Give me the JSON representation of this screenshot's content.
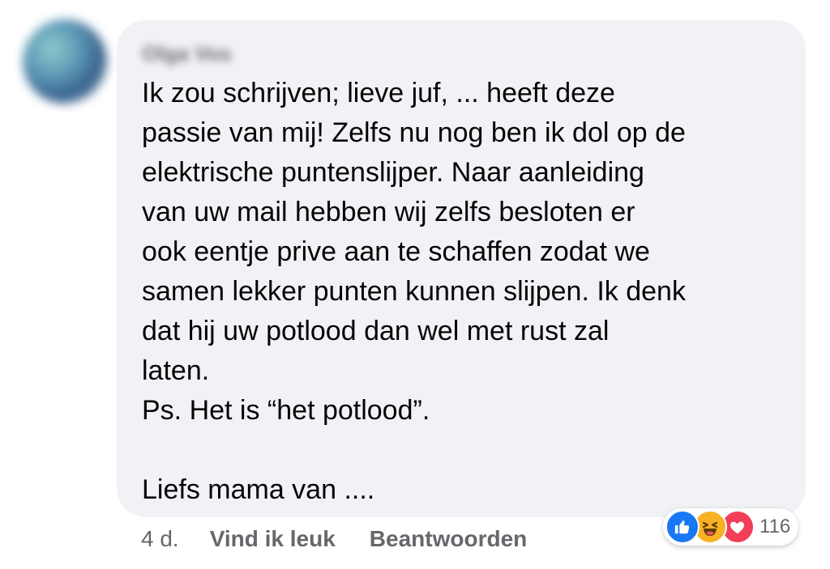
{
  "comment": {
    "author": "Olga Vos",
    "body": "Ik zou schrijven; lieve juf, ... heeft deze\npassie van mij! Zelfs nu nog ben ik dol op de\nelektrische puntenslijper. Naar aanleiding\nvan uw mail hebben wij zelfs besloten er\nook eentje prive aan te schaffen zodat we\nsamen lekker punten kunnen slijpen. Ik denk\ndat hij uw potlood dan wel met rust zal\nlaten.\nPs. Het is “het potlood”.\n\nLiefs mama van ...."
  },
  "actions": {
    "timestamp": "4 d.",
    "like_label": "Vind ik leuk",
    "reply_label": "Beantwoorden"
  },
  "reactions": {
    "icons": [
      "like-icon",
      "haha-icon",
      "love-icon"
    ],
    "count": "116",
    "colors": {
      "like": "#1877f2",
      "haha": "#f7b125",
      "love": "#f33e58"
    }
  },
  "colors": {
    "bubble_background": "#f0f2f5",
    "secondary_text": "#65676b",
    "primary_text": "#050505"
  }
}
